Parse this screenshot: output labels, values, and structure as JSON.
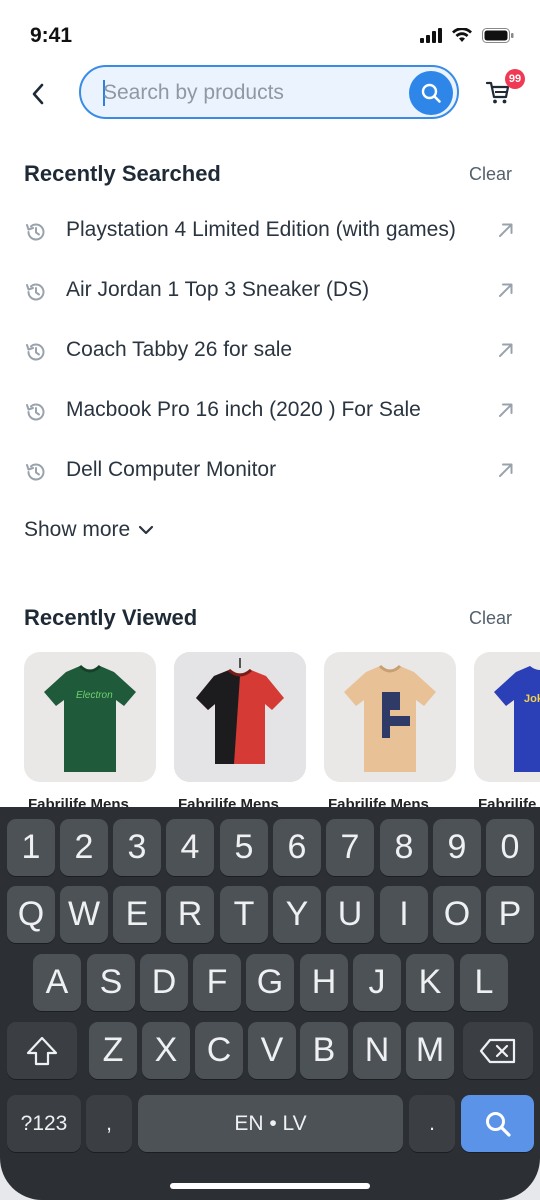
{
  "status": {
    "time": "9:41"
  },
  "search": {
    "placeholder": "Search by products",
    "value": ""
  },
  "cart": {
    "badge": "99"
  },
  "recently_searched": {
    "title": "Recently Searched",
    "clear_label": "Clear",
    "items": [
      "Playstation 4 Limited Edition (with games)",
      "Air Jordan 1 Top 3 Sneaker (DS)",
      "Coach Tabby 26 for sale",
      "Macbook Pro 16 inch (2020 ) For Sale",
      "Dell Computer Monitor"
    ],
    "show_more_label": "Show more"
  },
  "recently_viewed": {
    "title": "Recently Viewed",
    "clear_label": "Clear",
    "products": [
      {
        "label": "Fabrilife Mens",
        "shirt_color": "#1f5a3b",
        "print": "Electron"
      },
      {
        "label": "Fabrilife Mens",
        "shirt_color": "#d63a34",
        "print": ""
      },
      {
        "label": "Fabrilife Mens",
        "shirt_color": "#e8c197",
        "print": ""
      },
      {
        "label": "Fabrilife Mens",
        "shirt_color": "#2b3fb6",
        "print": "Joke"
      }
    ]
  },
  "keyboard": {
    "row_numbers": [
      "1",
      "2",
      "3",
      "4",
      "5",
      "6",
      "7",
      "8",
      "9",
      "0"
    ],
    "row_top": [
      "Q",
      "W",
      "E",
      "R",
      "T",
      "Y",
      "U",
      "I",
      "O",
      "P"
    ],
    "row_middle": [
      "A",
      "S",
      "D",
      "F",
      "G",
      "H",
      "J",
      "K",
      "L"
    ],
    "row_bottom": [
      "Z",
      "X",
      "C",
      "V",
      "B",
      "N",
      "M"
    ],
    "symbols_label": "?123",
    "comma_label": ",",
    "space_label": "EN • LV",
    "period_label": "."
  },
  "colors": {
    "accent": "#2e86e8",
    "badge": "#f03a55",
    "keyboard_bg": "#2c3034",
    "key_bg": "#4d5257",
    "search_key": "#5a93e8"
  }
}
